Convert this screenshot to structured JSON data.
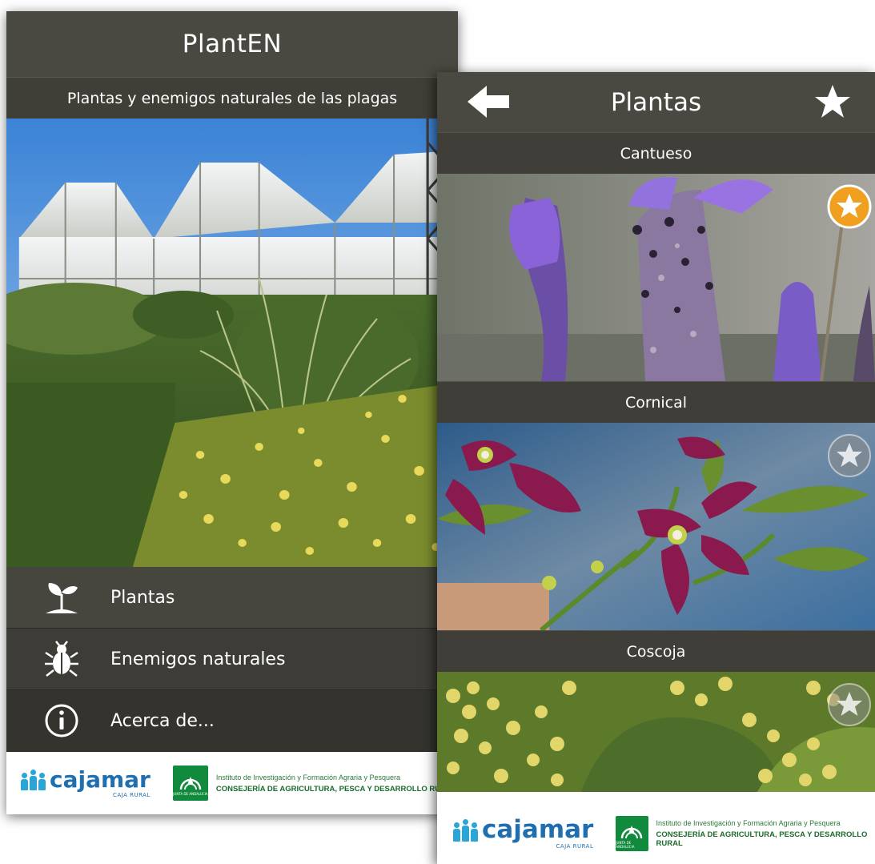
{
  "screen1": {
    "title": "PlantEN",
    "subtitle": "Plantas y enemigos naturales de las plagas",
    "menu": [
      {
        "label": "Plantas",
        "icon": "sprout-icon"
      },
      {
        "label": "Enemigos naturales",
        "icon": "beetle-icon"
      },
      {
        "label": "Acerca de...",
        "icon": "info-icon"
      }
    ]
  },
  "screen2": {
    "title": "Plantas",
    "back_icon": "back-arrow-icon",
    "favorites_icon": "star-icon",
    "plants": [
      {
        "name": "Cantueso",
        "favorite": true
      },
      {
        "name": "Cornical",
        "favorite": false
      },
      {
        "name": "Coscoja",
        "favorite": false
      }
    ]
  },
  "footer": {
    "cajamar_name": "cajamar",
    "cajamar_tag": "CAJA RURAL",
    "junta_emblem_text": "JUNTA DE ANDALUCIA",
    "junta_line1": "Instituto de Investigación y Formación Agraria y Pesquera",
    "junta_line2": "CONSEJERÍA DE AGRICULTURA, PESCA Y DESARROLLO RURAL"
  },
  "colors": {
    "header": "#4a4941",
    "favorite_active": "#f0a01e",
    "favorite_inactive": "#888888",
    "cajamar_blue": "#1f6fb0",
    "junta_green": "#118a3e"
  }
}
